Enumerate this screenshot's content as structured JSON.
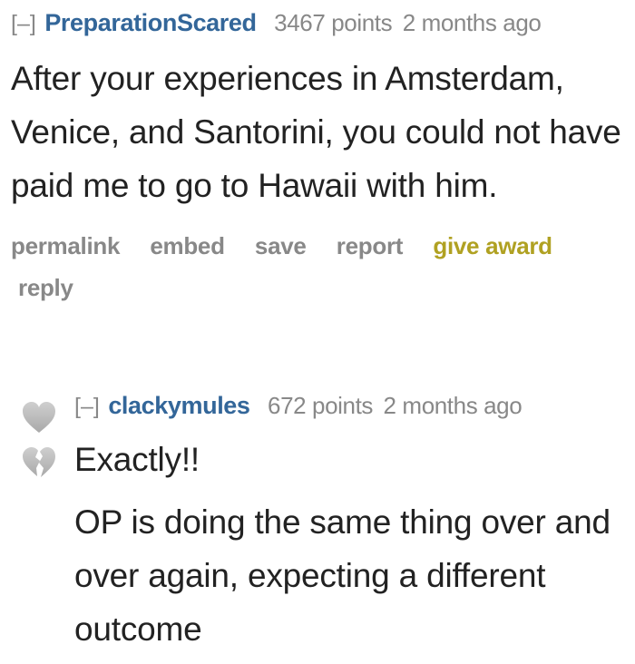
{
  "parent_comment": {
    "expand": "[–]",
    "author": "PreparationScared",
    "score": "3467 points",
    "time": "2 months ago",
    "body": "After your experiences in Amsterdam, Venice, and Santorini, you could not have paid me to go to Hawaii with him.",
    "buttons": {
      "permalink": "permalink",
      "embed": "embed",
      "save": "save",
      "report": "report",
      "give_award": "give award",
      "reply": "reply"
    }
  },
  "child_comment": {
    "expand": "[–]",
    "author": "clackymules",
    "score": "672 points",
    "time": "2 months ago",
    "paragraphs": [
      "Exactly!!",
      "OP is doing the same thing over and over again, expecting a different outcome"
    ],
    "upvote_icon": "heart-icon",
    "downvote_icon": "broken-heart-icon"
  },
  "colors": {
    "author": "#336699",
    "meta": "#888888",
    "award": "#b0a122",
    "text": "#222222"
  }
}
